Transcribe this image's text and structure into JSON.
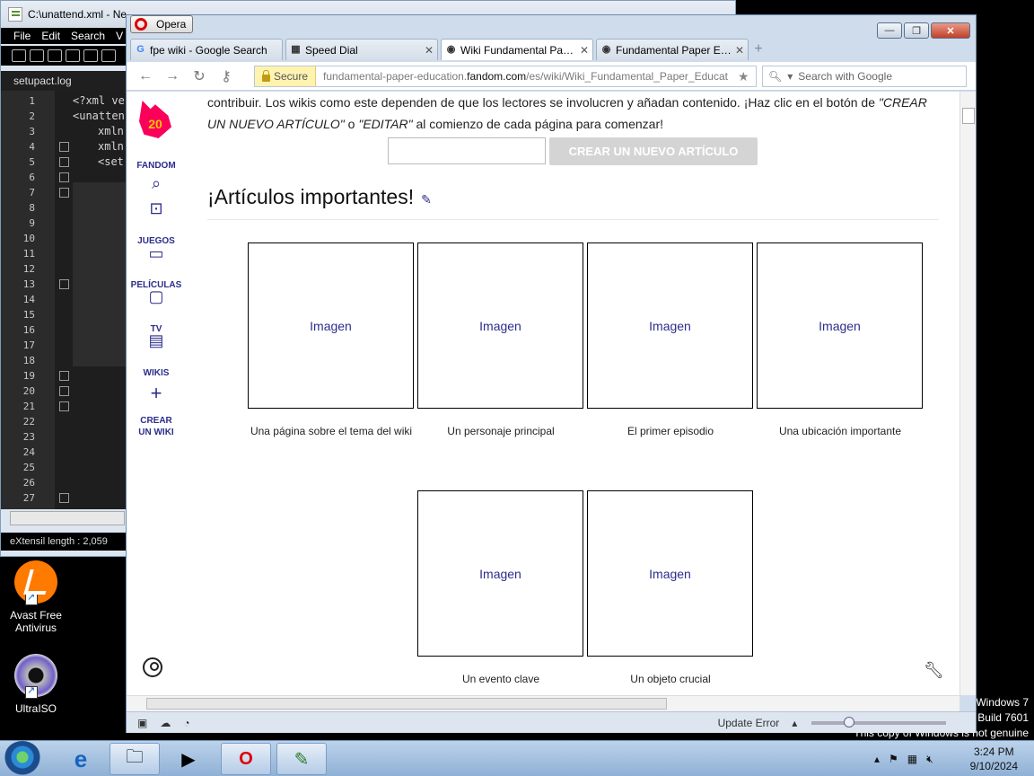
{
  "notepadpp": {
    "title": "C:\\unattend.xml - Ne",
    "menu": [
      "File",
      "Edit",
      "Search",
      "V"
    ],
    "tab": "setupact.log",
    "line_numbers": [
      "1",
      "2",
      "3",
      "4",
      "5",
      "6",
      "7",
      "8",
      "9",
      "10",
      "11",
      "12",
      "13",
      "14",
      "15",
      "16",
      "17",
      "18",
      "19",
      "20",
      "21",
      "22",
      "23",
      "24",
      "25",
      "26",
      "27"
    ],
    "code": [
      "<?xml ve",
      "<unatten",
      "xmln",
      "xmln",
      "<set"
    ],
    "status": "eXtensil  length : 2,059"
  },
  "desktop": {
    "icons": [
      {
        "label": "Avast Free Antivirus"
      },
      {
        "label": "UltraISO"
      }
    ],
    "watermark": [
      "Windows 7",
      "Build 7601",
      "This copy of Windows is not genuine"
    ]
  },
  "opera": {
    "menu_label": "Opera",
    "tabs": [
      {
        "label": "fpe wiki - Google Search",
        "favicon": "G"
      },
      {
        "label": "Speed Dial",
        "favicon": "▦"
      },
      {
        "label": "Wiki Fundamental Pap...",
        "favicon": "◉",
        "active": true
      },
      {
        "label": "Fundamental Paper Ed...",
        "favicon": "◉"
      }
    ],
    "secure_label": "Secure",
    "url_prefix": "fundamental-paper-education.",
    "url_domain": "fandom.com",
    "url_suffix": "/es/wiki/Wiki_Fundamental_Paper_Educat",
    "search_placeholder": "Search with Google",
    "status": "Update Error"
  },
  "fandom": {
    "logo_text": "20",
    "rail": {
      "fandom": "FANDOM",
      "juegos": "JUEGOS",
      "peliculas": "PELÍCULAS",
      "tv": "TV",
      "wikis": "WIKIS",
      "crear": "CREAR UN WIKI"
    },
    "intro_1": "contribuir. Los wikis como este dependen de que los lectores se involucren y añadan contenido. ¡Haz clic en el botón de ",
    "intro_q1": "\"CREAR UN NUEVO ARTÍCULO\"",
    "intro_2": " o ",
    "intro_q2": "\"EDITAR\"",
    "intro_3": " al comienzo de cada página para comenzar!",
    "create_button": "CREAR UN NUEVO ARTÍCULO",
    "section_title": "¡Artículos importantes!",
    "gallery": [
      {
        "image": "Imagen",
        "caption": "Una página sobre el tema del wiki"
      },
      {
        "image": "Imagen",
        "caption": "Un personaje principal"
      },
      {
        "image": "Imagen",
        "caption": "El primer episodio"
      },
      {
        "image": "Imagen",
        "caption": "Una ubicación importante"
      },
      {
        "image": "Imagen",
        "caption": "Un evento clave"
      },
      {
        "image": "Imagen",
        "caption": "Un objeto crucial"
      }
    ]
  },
  "taskbar": {
    "time": "3:24 PM",
    "date": "9/10/2024"
  }
}
